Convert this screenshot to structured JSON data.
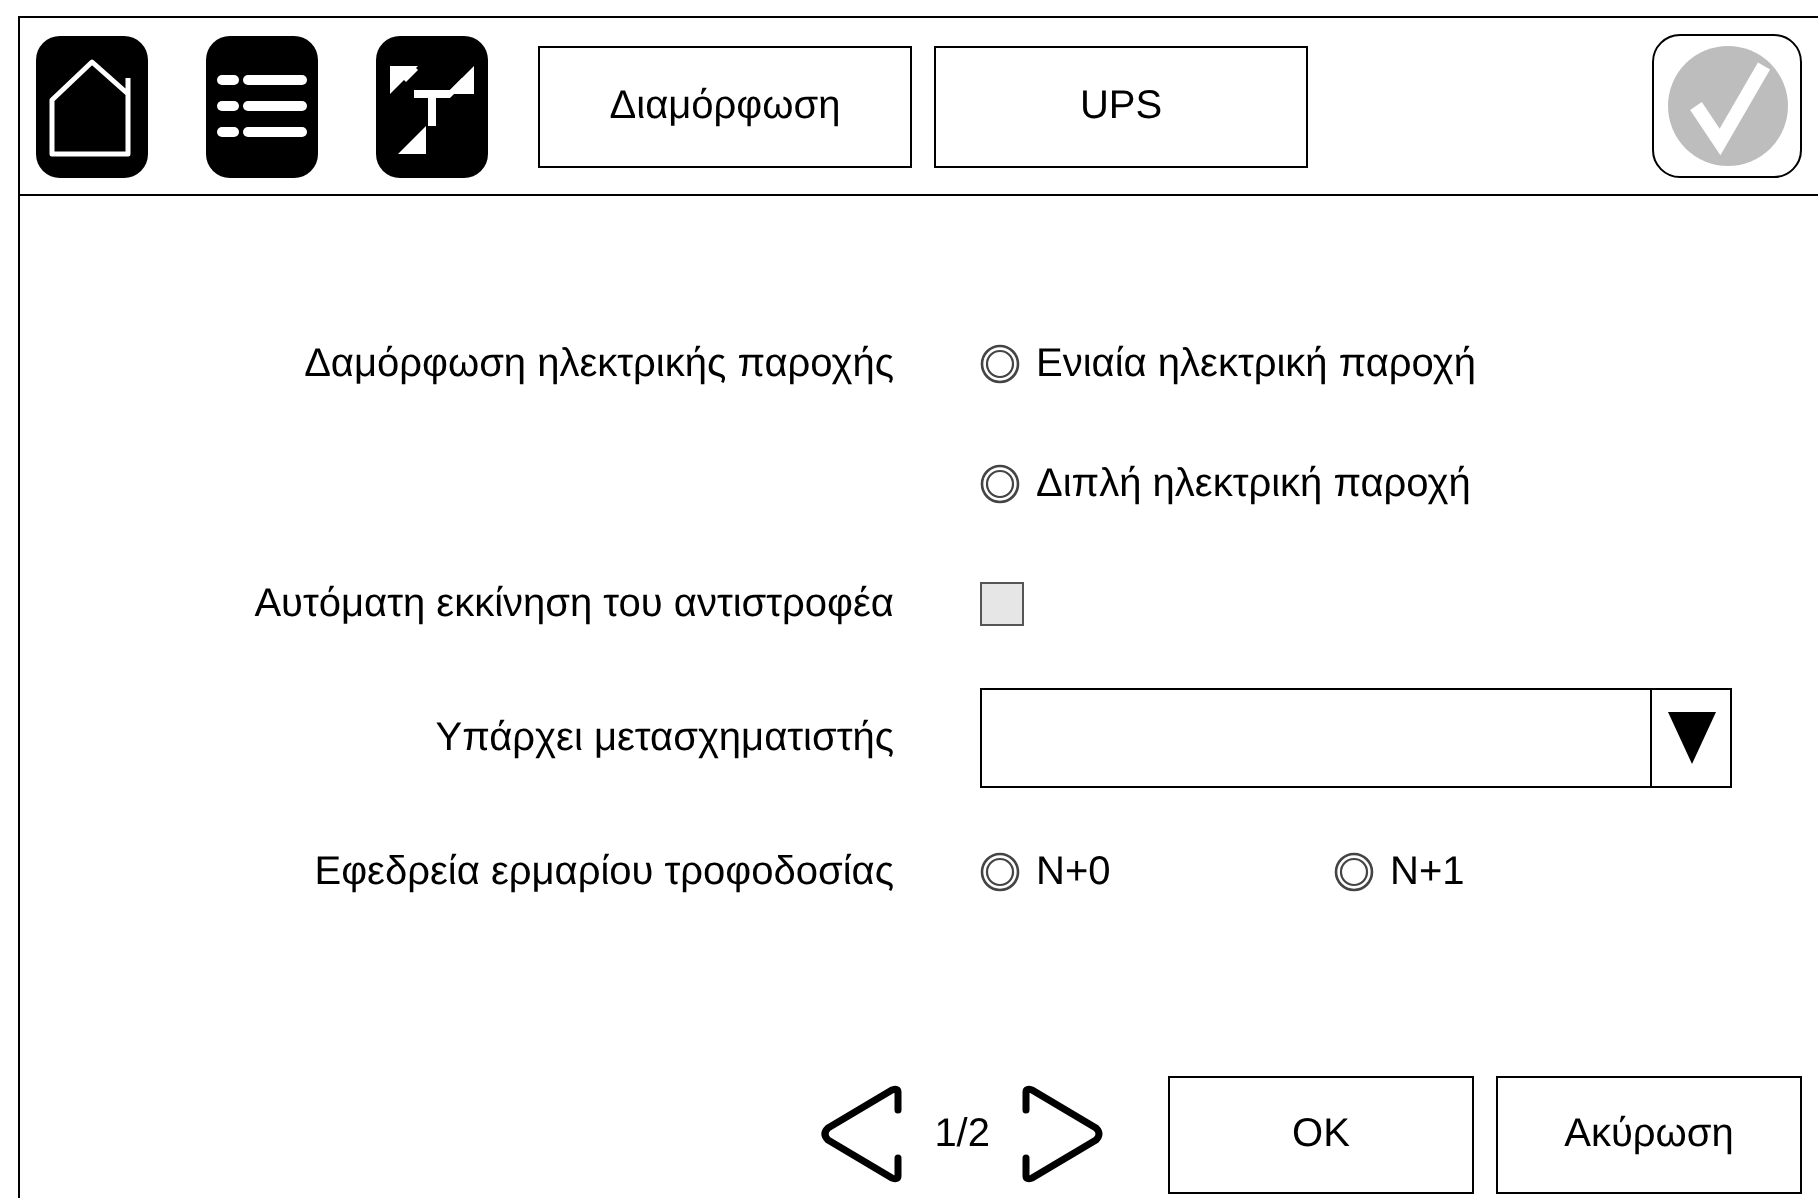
{
  "tabs": [
    {
      "label": "Διαμόρφωση"
    },
    {
      "label": "UPS"
    }
  ],
  "fields": [
    {
      "kind": "radio_column",
      "label": "Δαμόρφωση ηλεκτρικής παροχής",
      "options": [
        {
          "label": "Ενιαία ηλεκτρική παροχή",
          "selected": false
        },
        {
          "label": "Διπλή ηλεκτρική παροχή",
          "selected": false
        }
      ]
    },
    {
      "kind": "checkbox",
      "label": "Αυτόματη εκκίνηση του αντιστροφέα",
      "checked": false
    },
    {
      "kind": "dropdown",
      "label": "Υπάρχει μετασχηματιστής"
    },
    {
      "kind": "radio_row",
      "label": "Εφεδρεία ερμαρίου τροφοδοσίας",
      "options": [
        {
          "label": "N+0",
          "selected": false
        },
        {
          "label": "N+1",
          "selected": false
        }
      ]
    }
  ],
  "pager": "1/2",
  "buttons": [
    "OK",
    "Ακύρωση"
  ]
}
